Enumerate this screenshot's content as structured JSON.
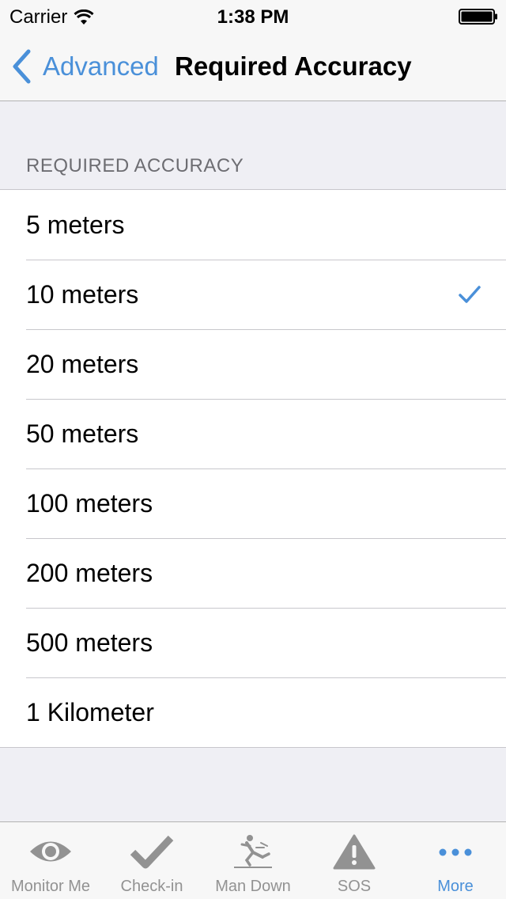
{
  "status_bar": {
    "carrier": "Carrier",
    "time": "1:38 PM"
  },
  "nav": {
    "back_label": "Advanced",
    "title": "Required Accuracy"
  },
  "section": {
    "header": "REQUIRED ACCURACY"
  },
  "options": [
    {
      "label": "5 meters",
      "selected": false
    },
    {
      "label": "10 meters",
      "selected": true
    },
    {
      "label": "20 meters",
      "selected": false
    },
    {
      "label": "50 meters",
      "selected": false
    },
    {
      "label": "100 meters",
      "selected": false
    },
    {
      "label": "200 meters",
      "selected": false
    },
    {
      "label": "500 meters",
      "selected": false
    },
    {
      "label": "1 Kilometer",
      "selected": false
    }
  ],
  "tabs": [
    {
      "label": "Monitor Me",
      "icon": "eye-icon",
      "active": false
    },
    {
      "label": "Check-in",
      "icon": "checkmark-icon",
      "active": false
    },
    {
      "label": "Man Down",
      "icon": "falling-person-icon",
      "active": false
    },
    {
      "label": "SOS",
      "icon": "warning-icon",
      "active": false
    },
    {
      "label": "More",
      "icon": "more-dots-icon",
      "active": true
    }
  ],
  "colors": {
    "accent": "#4a90d9",
    "tab_inactive": "#929292",
    "background": "#efeff4"
  }
}
